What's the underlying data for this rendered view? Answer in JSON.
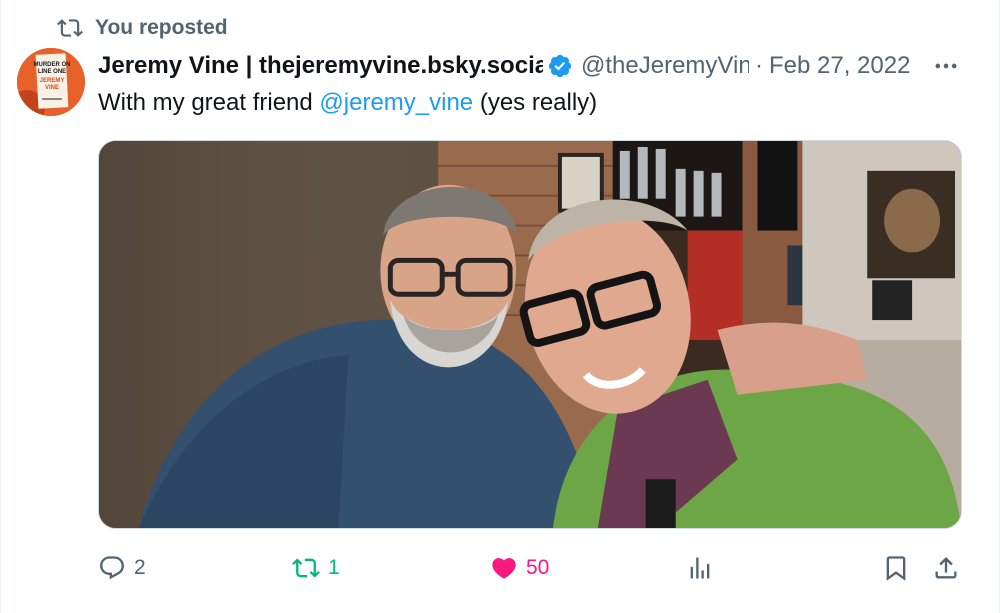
{
  "social_context": {
    "label": "You reposted",
    "icon": "repost-icon"
  },
  "author": {
    "display_name": "Jeremy Vine | thejeremyvine.bsky.social",
    "handle": "@theJeremyVine",
    "verified": true,
    "avatar_text": [
      "MURDER ON",
      "LINE ONE",
      "JEREMY",
      "VINE"
    ]
  },
  "separator": "·",
  "date": "Feb 27, 2022",
  "post": {
    "text_before": "With my great friend ",
    "mention": "@jeremy_vine",
    "text_after": " (yes really)"
  },
  "actions": {
    "replies": "2",
    "reposts": "1",
    "likes": "50"
  },
  "colors": {
    "accent": "#1d9bf0",
    "repost_active": "#00ba7c",
    "like_active": "#f91880",
    "secondary_text": "#536471"
  }
}
